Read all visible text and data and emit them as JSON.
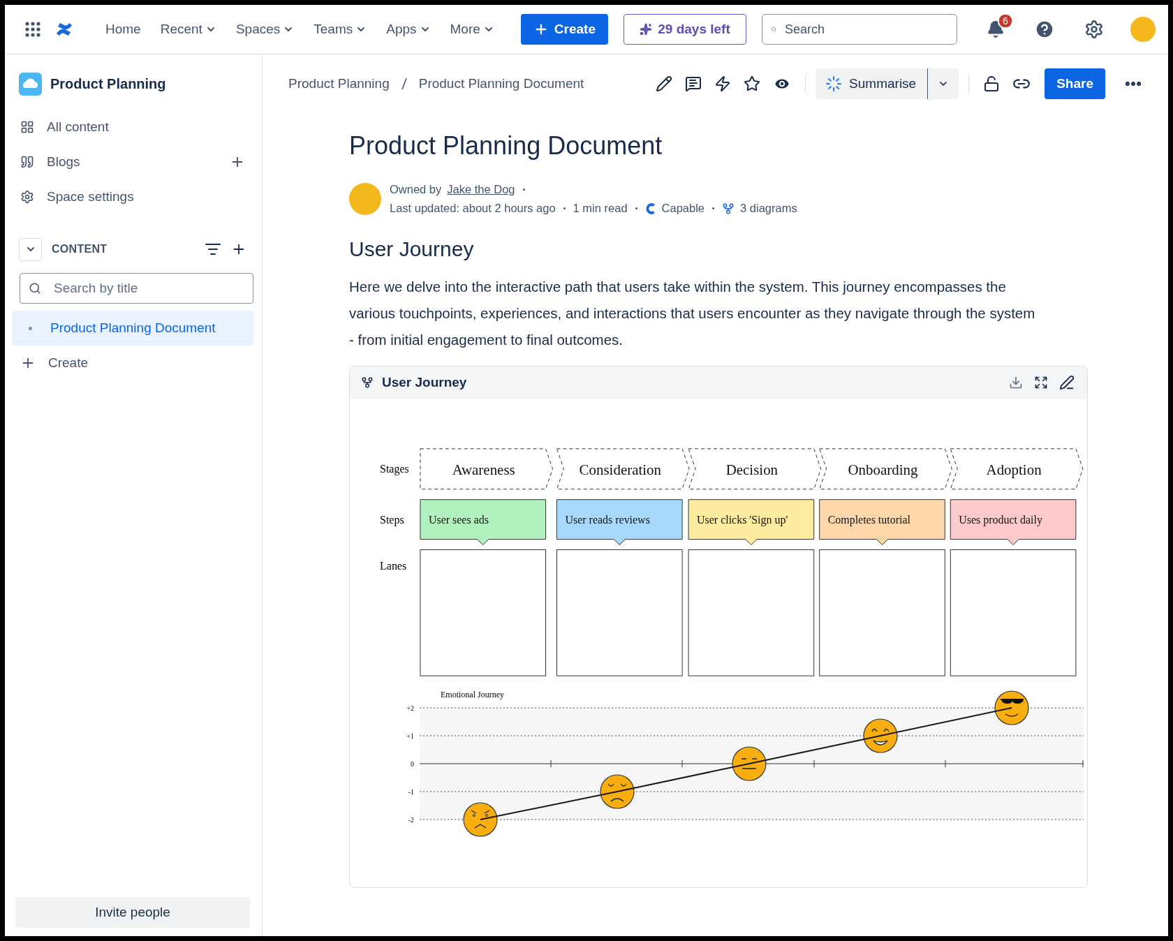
{
  "topbar": {
    "nav": [
      {
        "label": "Home",
        "dropdown": false
      },
      {
        "label": "Recent",
        "dropdown": true
      },
      {
        "label": "Spaces",
        "dropdown": true
      },
      {
        "label": "Teams",
        "dropdown": true
      },
      {
        "label": "Apps",
        "dropdown": true
      },
      {
        "label": "More",
        "dropdown": true
      }
    ],
    "create": "Create",
    "trial": "29 days left",
    "search": {
      "placeholder": "Search"
    },
    "notifications": "6"
  },
  "sidebar": {
    "space": "Product Planning",
    "items": [
      {
        "label": "All content",
        "kind": "grid",
        "add": false
      },
      {
        "label": "Blogs",
        "kind": "quote",
        "add": true
      },
      {
        "label": "Space settings",
        "kind": "gear",
        "add": false
      }
    ],
    "section": {
      "label": "CONTENT",
      "expanded": true
    },
    "search": {
      "placeholder": "Search by title"
    },
    "tree": [
      {
        "label": "Product Planning Document",
        "selected": true
      }
    ],
    "create": "Create",
    "invite": "Invite people"
  },
  "page": {
    "breadcrumb": [
      "Product Planning",
      "Product Planning Document"
    ],
    "summarise": "Summarise",
    "share": "Share",
    "title": "Product Planning Document",
    "owned_by": "Owned by",
    "owner": "Jake the Dog",
    "updated": "Last updated: about 2 hours ago",
    "read_time": "1 min read",
    "app": "Capable",
    "diagrams": "3 diagrams",
    "heading": "User Journey",
    "paragraph": "Here we delve into the interactive path that users take within the system. This journey encompasses the various touchpoints, experiences, and interactions that users encounter as they navigate through the system - from initial engagement to final outcomes."
  },
  "diagram": {
    "title": "User Journey",
    "row_labels": [
      "Stages",
      "Steps",
      "Lanes"
    ],
    "stages": [
      {
        "name": "Awareness",
        "step": "User sees ads",
        "color": "#b3f0bf"
      },
      {
        "name": "Consideration",
        "step": "User reads reviews",
        "color": "#a8d8fb"
      },
      {
        "name": "Decision",
        "step": "User clicks 'Sign up'",
        "color": "#fdeba0"
      },
      {
        "name": "Onboarding",
        "step": "Completes tutorial",
        "color": "#fdd7a9"
      },
      {
        "name": "Adoption",
        "step": "Uses product daily",
        "color": "#fccaca"
      }
    ],
    "chart_data": {
      "type": "line",
      "title": "Emotional Journey",
      "series": [
        {
          "color": "#1a1a1a",
          "values": [
            -2,
            -1,
            0,
            1,
            2
          ]
        }
      ],
      "ylim": [
        -2,
        2
      ],
      "yticks": [
        {
          "value": 2,
          "label": "+2"
        },
        {
          "value": 1,
          "label": "+1"
        },
        {
          "value": 0,
          "label": "0"
        },
        {
          "value": -1,
          "label": "-1"
        },
        {
          "value": -2,
          "label": "-2"
        }
      ]
    }
  }
}
